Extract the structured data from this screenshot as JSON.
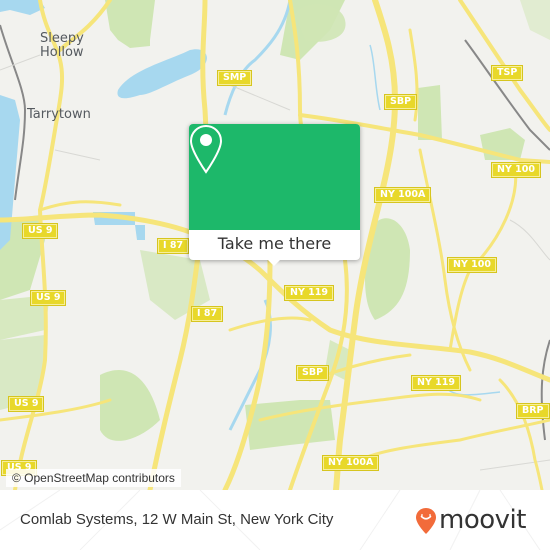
{
  "map": {
    "place_labels": [
      {
        "id": "sleepy-hollow",
        "text": "Sleepy\nHollow"
      },
      {
        "id": "tarrytown",
        "text": "Tarrytown"
      }
    ],
    "road_shields": [
      {
        "id": "smp",
        "text": "SMP"
      },
      {
        "id": "sbp-north",
        "text": "SBP"
      },
      {
        "id": "tsp",
        "text": "TSP"
      },
      {
        "id": "ny100-east",
        "text": "NY 100"
      },
      {
        "id": "ny100a-north",
        "text": "NY 100A"
      },
      {
        "id": "us9-north",
        "text": "US 9"
      },
      {
        "id": "i87-north",
        "text": "I 87"
      },
      {
        "id": "ny100-mid",
        "text": "NY 100"
      },
      {
        "id": "ny119-west",
        "text": "NY 119"
      },
      {
        "id": "us9-mid",
        "text": "US 9"
      },
      {
        "id": "i87-south",
        "text": "I 87"
      },
      {
        "id": "sbp-south",
        "text": "SBP"
      },
      {
        "id": "ny119-east",
        "text": "NY 119"
      },
      {
        "id": "brp",
        "text": "BRP"
      },
      {
        "id": "us9-south",
        "text": "US 9"
      },
      {
        "id": "ny100a-south",
        "text": "NY 100A"
      },
      {
        "id": "us9-bottom",
        "text": "US 9"
      }
    ],
    "attribution": "© OpenStreetMap contributors",
    "colors": {
      "land": "#f2f2ee",
      "park": "#cfe6b4",
      "water": "#a7d8ef",
      "road": "#f6e57a",
      "shield": "#e8d82a"
    }
  },
  "popup": {
    "icon": "location-pin-icon",
    "button_label": "Take me there",
    "color": "#1db86a"
  },
  "footer": {
    "address": "Comlab Systems, 12 W Main St, New York City",
    "brand": "moovit",
    "brand_color": "#f26b3a"
  }
}
